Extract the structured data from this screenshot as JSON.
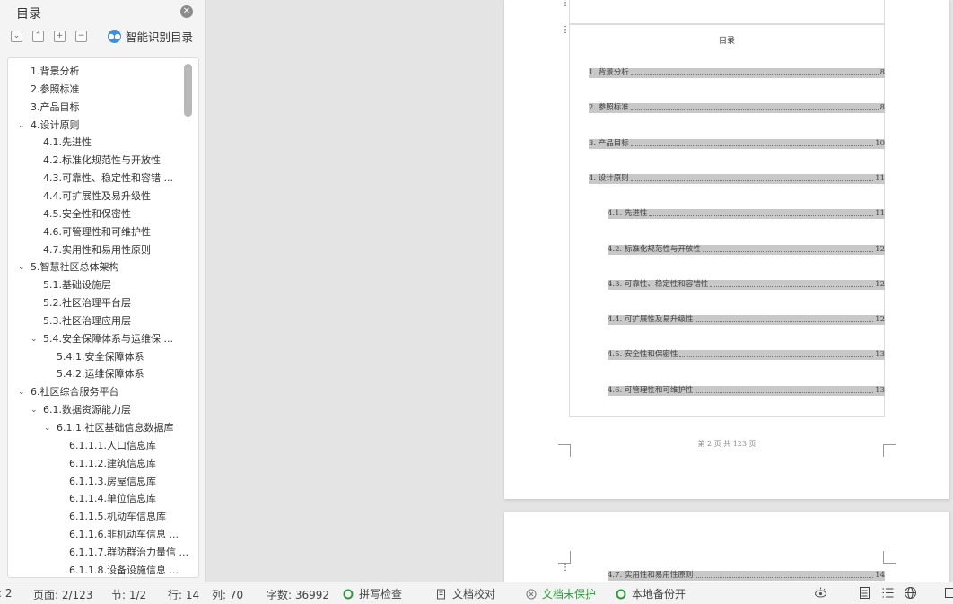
{
  "toc_panel": {
    "title": "目录",
    "close_icon": "close-icon",
    "smart_toc_label": "智能识别目录",
    "items": [
      {
        "label": "1.背景分析",
        "level": 0,
        "expanded": null
      },
      {
        "label": "2.参照标准",
        "level": 0,
        "expanded": null
      },
      {
        "label": "3.产品目标",
        "level": 0,
        "expanded": null
      },
      {
        "label": "4.设计原则",
        "level": 0,
        "expanded": true
      },
      {
        "label": "4.1.先进性",
        "level": 1,
        "expanded": null
      },
      {
        "label": "4.2.标准化规范性与开放性",
        "level": 1,
        "expanded": null
      },
      {
        "label": "4.3.可靠性、稳定性和容错 ...",
        "level": 1,
        "expanded": null
      },
      {
        "label": "4.4.可扩展性及易升级性",
        "level": 1,
        "expanded": null
      },
      {
        "label": "4.5.安全性和保密性",
        "level": 1,
        "expanded": null
      },
      {
        "label": "4.6.可管理性和可维护性",
        "level": 1,
        "expanded": null
      },
      {
        "label": "4.7.实用性和易用性原则",
        "level": 1,
        "expanded": null
      },
      {
        "label": "5.智慧社区总体架构",
        "level": 0,
        "expanded": true
      },
      {
        "label": "5.1.基础设施层",
        "level": 1,
        "expanded": null
      },
      {
        "label": "5.2.社区治理平台层",
        "level": 1,
        "expanded": null
      },
      {
        "label": "5.3.社区治理应用层",
        "level": 1,
        "expanded": null
      },
      {
        "label": "5.4.安全保障体系与运维保 ...",
        "level": 1,
        "expanded": true
      },
      {
        "label": "5.4.1.安全保障体系",
        "level": 2,
        "expanded": null
      },
      {
        "label": "5.4.2.运维保障体系",
        "level": 2,
        "expanded": null
      },
      {
        "label": "6.社区综合服务平台",
        "level": 0,
        "expanded": true
      },
      {
        "label": "6.1.数据资源能力层",
        "level": 1,
        "expanded": true
      },
      {
        "label": "6.1.1.社区基础信息数据库",
        "level": 2,
        "expanded": true
      },
      {
        "label": "6.1.1.1.人口信息库",
        "level": 3,
        "expanded": null
      },
      {
        "label": "6.1.1.2.建筑信息库",
        "level": 3,
        "expanded": null
      },
      {
        "label": "6.1.1.3.房屋信息库",
        "level": 3,
        "expanded": null
      },
      {
        "label": "6.1.1.4.单位信息库",
        "level": 3,
        "expanded": null
      },
      {
        "label": "6.1.1.5.机动车信息库",
        "level": 3,
        "expanded": null
      },
      {
        "label": "6.1.1.6.非机动车信息 ...",
        "level": 3,
        "expanded": null
      },
      {
        "label": "6.1.1.7.群防群治力量信 ...",
        "level": 3,
        "expanded": null
      },
      {
        "label": "6.1.1.8.设备设施信息 ...",
        "level": 3,
        "expanded": null
      }
    ]
  },
  "document": {
    "toc_heading": "目录",
    "entries": [
      {
        "label": "1. 背景分析",
        "page": "8",
        "level": 0
      },
      {
        "label": "2. 参照标准",
        "page": "8",
        "level": 0
      },
      {
        "label": "3. 产品目标",
        "page": "10",
        "level": 0
      },
      {
        "label": "4. 设计原则",
        "page": "11",
        "level": 0
      },
      {
        "label": "4.1. 先进性",
        "page": "11",
        "level": 1
      },
      {
        "label": "4.2. 标准化规范性与开放性",
        "page": "12",
        "level": 1
      },
      {
        "label": "4.3. 可靠性、稳定性和容错性",
        "page": "12",
        "level": 1
      },
      {
        "label": "4.4. 可扩展性及易升级性",
        "page": "12",
        "level": 1
      },
      {
        "label": "4.5. 安全性和保密性",
        "page": "13",
        "level": 1
      },
      {
        "label": "4.6. 可管理性和可维护性",
        "page": "13",
        "level": 1
      }
    ],
    "footer": "第 2 页 共 123 页",
    "next_page_entry": {
      "label": "4.7. 实用性和易用性原则",
      "page": "14"
    }
  },
  "status_bar": {
    "partial_left": ": 2",
    "page": "页面: 2/123",
    "section": "节: 1/2",
    "row": "行: 14",
    "column": "列: 70",
    "word_count": "字数: 36992",
    "spell_check": "拼写检查",
    "doc_proofread": "文档校对",
    "doc_unprotected": "文档未保护",
    "local_backup": "本地备份开",
    "colors": {
      "green": "#2e9a3c",
      "accent": "#3a8ee6"
    }
  }
}
